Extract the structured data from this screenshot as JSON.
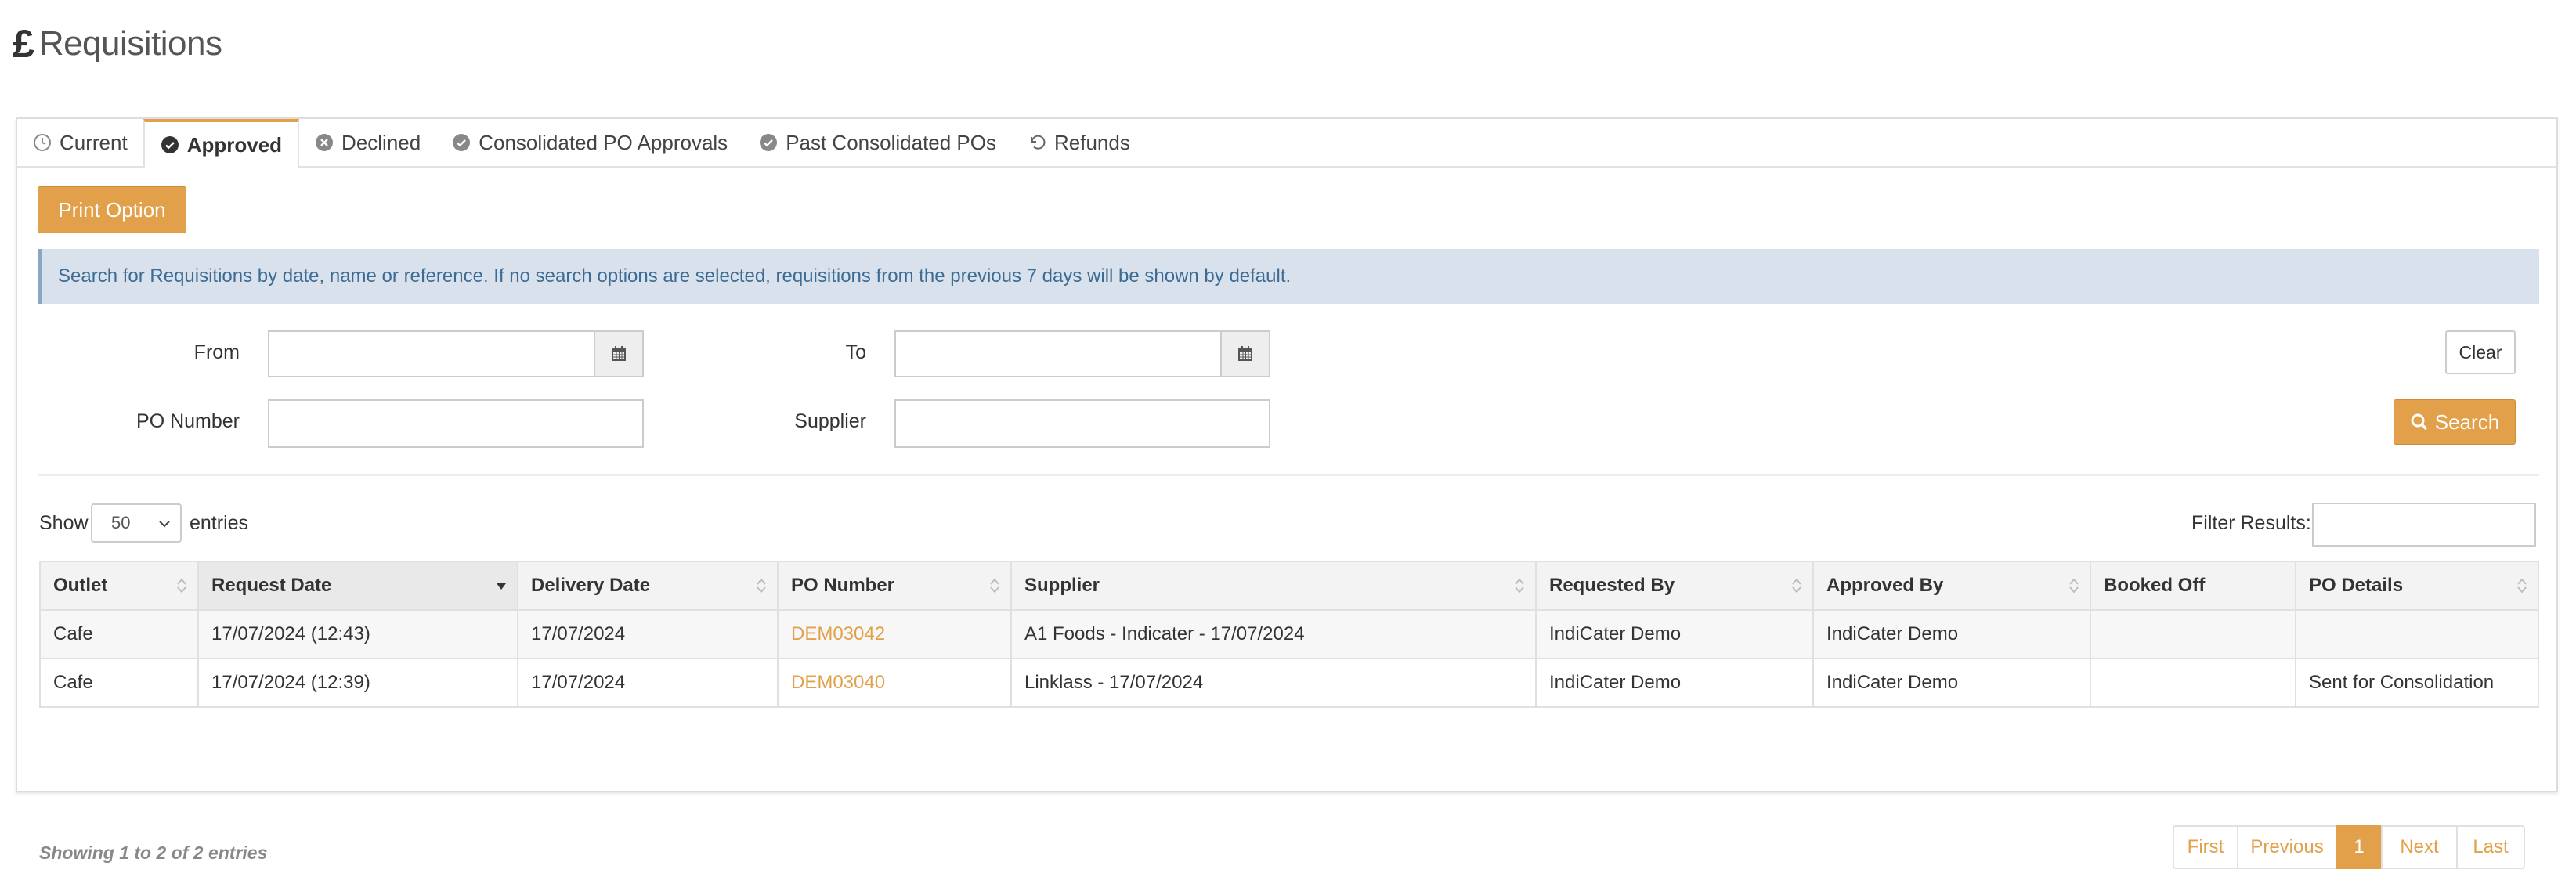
{
  "page": {
    "title_icon": "pound-sign-icon",
    "title": "Requisitions"
  },
  "tabs": [
    {
      "label": "Current",
      "icon": "clock-icon",
      "active": false
    },
    {
      "label": "Approved",
      "icon": "check-circle-icon",
      "active": true
    },
    {
      "label": "Declined",
      "icon": "x-circle-icon",
      "active": false
    },
    {
      "label": "Consolidated PO Approvals",
      "icon": "check-circle-icon",
      "active": false
    },
    {
      "label": "Past Consolidated POs",
      "icon": "check-circle-icon",
      "active": false
    },
    {
      "label": "Refunds",
      "icon": "undo-icon",
      "active": false
    }
  ],
  "toolbar": {
    "print_label": "Print Option"
  },
  "info": {
    "text": "Search for Requisitions by date, name or reference. If no search options are selected, requisitions from the previous 7 days will be shown by default."
  },
  "filters": {
    "from_label": "From",
    "from_value": "",
    "to_label": "To",
    "to_value": "",
    "po_label": "PO Number",
    "po_value": "",
    "supplier_label": "Supplier",
    "supplier_value": "",
    "clear_label": "Clear",
    "search_label": "Search"
  },
  "table_controls": {
    "show_label": "Show",
    "entries_value": "50",
    "entries_label": "entries",
    "filter_label": "Filter Results:",
    "filter_value": ""
  },
  "table": {
    "columns": [
      "Outlet",
      "Request Date",
      "Delivery Date",
      "PO Number",
      "Supplier",
      "Requested By",
      "Approved By",
      "Booked Off",
      "PO Details"
    ],
    "sorted_column": "Request Date",
    "rows": [
      {
        "outlet": "Cafe",
        "request_date": "17/07/2024 (12:43)",
        "delivery_date": "17/07/2024",
        "po_number": "DEM03042",
        "supplier": "A1 Foods - Indicater - 17/07/2024",
        "requested_by": "IndiCater Demo",
        "approved_by": "IndiCater Demo",
        "booked_off": "",
        "po_details": ""
      },
      {
        "outlet": "Cafe",
        "request_date": "17/07/2024 (12:39)",
        "delivery_date": "17/07/2024",
        "po_number": "DEM03040",
        "supplier": "Linklass - 17/07/2024",
        "requested_by": "IndiCater Demo",
        "approved_by": "IndiCater Demo",
        "booked_off": "",
        "po_details": "Sent for Consolidation"
      }
    ]
  },
  "footer": {
    "showing_text": "Showing 1 to 2 of 2 entries"
  },
  "pagination": {
    "first": "First",
    "previous": "Previous",
    "current": "1",
    "next": "Next",
    "last": "Last"
  },
  "colors": {
    "accent": "#e2a04a",
    "info_bg": "#d9e2ec",
    "info_text": "#3c6b94"
  }
}
